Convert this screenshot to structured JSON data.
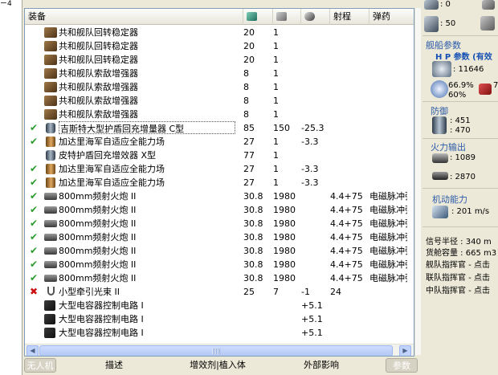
{
  "left_fragment": "ㄧ4",
  "table": {
    "headers": {
      "name": "装备",
      "range": "射程",
      "ammo": "弹药"
    },
    "header_icons": [
      "cpu-icon",
      "powergrid-icon",
      "capacitor-icon"
    ],
    "rows": [
      {
        "status": "",
        "icon": "rig",
        "name": "共和舰队回转稳定器",
        "c1": "20",
        "c2": "1",
        "c3": "",
        "c4": "",
        "c5": ""
      },
      {
        "status": "",
        "icon": "rig",
        "name": "共和舰队回转稳定器",
        "c1": "20",
        "c2": "1",
        "c3": "",
        "c4": "",
        "c5": ""
      },
      {
        "status": "",
        "icon": "rig",
        "name": "共和舰队回转稳定器",
        "c1": "20",
        "c2": "1",
        "c3": "",
        "c4": "",
        "c5": ""
      },
      {
        "status": "",
        "icon": "rig",
        "name": "共和舰队索敌增强器",
        "c1": "8",
        "c2": "1",
        "c3": "",
        "c4": "",
        "c5": ""
      },
      {
        "status": "",
        "icon": "rig",
        "name": "共和舰队索敌增强器",
        "c1": "8",
        "c2": "1",
        "c3": "",
        "c4": "",
        "c5": ""
      },
      {
        "status": "",
        "icon": "rig",
        "name": "共和舰队索敌增强器",
        "c1": "8",
        "c2": "1",
        "c3": "",
        "c4": "",
        "c5": ""
      },
      {
        "status": "",
        "icon": "rig",
        "name": "共和舰队索敌增强器",
        "c1": "8",
        "c2": "1",
        "c3": "",
        "c4": "",
        "c5": ""
      },
      {
        "status": "✔",
        "icon": "shield",
        "name": "吉斯特大型护盾回充增量器 C型",
        "c1": "85",
        "c2": "150",
        "c3": "-25.3",
        "c4": "",
        "c5": "",
        "selected": true
      },
      {
        "status": "✔",
        "icon": "armor",
        "name": "加达里海军自适应全能力场",
        "c1": "27",
        "c2": "1",
        "c3": "-3.3",
        "c4": "",
        "c5": ""
      },
      {
        "status": "",
        "icon": "shield",
        "name": "皮特护盾回充增效器 X型",
        "c1": "77",
        "c2": "1",
        "c3": "",
        "c4": "",
        "c5": ""
      },
      {
        "status": "✔",
        "icon": "armor",
        "name": "加达里海军自适应全能力场",
        "c1": "27",
        "c2": "1",
        "c3": "-3.3",
        "c4": "",
        "c5": ""
      },
      {
        "status": "✔",
        "icon": "armor",
        "name": "加达里海军自适应全能力场",
        "c1": "27",
        "c2": "1",
        "c3": "-3.3",
        "c4": "",
        "c5": ""
      },
      {
        "status": "✔",
        "icon": "gun",
        "name": "800mm频射火炮 II",
        "c1": "30.8",
        "c2": "1980",
        "c3": "",
        "c4": "4.4+75",
        "c5": "电磁脉冲弹"
      },
      {
        "status": "✔",
        "icon": "gun",
        "name": "800mm频射火炮 II",
        "c1": "30.8",
        "c2": "1980",
        "c3": "",
        "c4": "4.4+75",
        "c5": "电磁脉冲弹"
      },
      {
        "status": "✔",
        "icon": "gun",
        "name": "800mm频射火炮 II",
        "c1": "30.8",
        "c2": "1980",
        "c3": "",
        "c4": "4.4+75",
        "c5": "电磁脉冲弹"
      },
      {
        "status": "✔",
        "icon": "gun",
        "name": "800mm频射火炮 II",
        "c1": "30.8",
        "c2": "1980",
        "c3": "",
        "c4": "4.4+75",
        "c5": "电磁脉冲弹"
      },
      {
        "status": "✔",
        "icon": "gun",
        "name": "800mm频射火炮 II",
        "c1": "30.8",
        "c2": "1980",
        "c3": "",
        "c4": "4.4+75",
        "c5": "电磁脉冲弹"
      },
      {
        "status": "✔",
        "icon": "gun",
        "name": "800mm频射火炮 II",
        "c1": "30.8",
        "c2": "1980",
        "c3": "",
        "c4": "4.4+75",
        "c5": "电磁脉冲弹"
      },
      {
        "status": "✔",
        "icon": "gun",
        "name": "800mm频射火炮 II",
        "c1": "30.8",
        "c2": "1980",
        "c3": "",
        "c4": "4.4+75",
        "c5": "电磁脉冲弹"
      },
      {
        "status": "✖",
        "icon": "beam",
        "name": "小型牵引光束 II",
        "c1": "25",
        "c2": "7",
        "c3": "-1",
        "c4": "24",
        "c5": ""
      },
      {
        "status": "",
        "icon": "chip",
        "name": "大型电容器控制电路 I",
        "c1": "",
        "c2": "",
        "c3": "+5.1",
        "c4": "",
        "c5": ""
      },
      {
        "status": "",
        "icon": "chip",
        "name": "大型电容器控制电路 I",
        "c1": "",
        "c2": "",
        "c3": "+5.1",
        "c4": "",
        "c5": ""
      },
      {
        "status": "",
        "icon": "chip",
        "name": "大型电容器控制电路 I",
        "c1": "",
        "c2": "",
        "c3": "+5.1",
        "c4": "",
        "c5": ""
      }
    ]
  },
  "bottom_tabs": [
    "无人机",
    "描述",
    "增效剂|植入体",
    "外部影响",
    "参数"
  ],
  "right": {
    "top_val1": ": 0",
    "top_val2": ": 50",
    "ship_params_title": "舰船参数",
    "hp_title": "H P 参数 (有效",
    "hp_value": ": 11646",
    "pct1": "66.9%",
    "pct2": "60%",
    "pct_extra": "7",
    "defense_title": "防御",
    "def1": ": 451",
    "def2": ": 470",
    "firepower_title": "火力输出",
    "fire1": ": 1089",
    "fire2": ": 2870",
    "mobility_title": "机动能力",
    "speed": ": 201 m/s",
    "lines": [
      "信号半径 : 340 m",
      "货舱容量 : 665 m3",
      "舰队指挥官 - 点击",
      "联队指挥官 - 点击",
      "中队指挥官 - 点击"
    ]
  }
}
